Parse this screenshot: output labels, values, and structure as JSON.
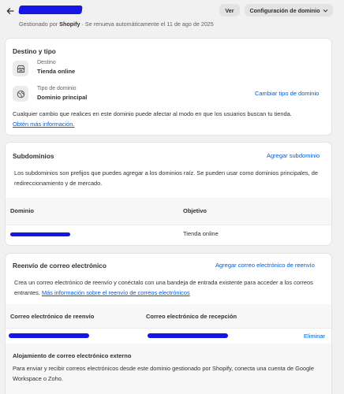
{
  "header": {
    "back_icon": "arrow-left-icon",
    "subtitle_prefix": "Gestionado por",
    "subtitle_brand": "Shopify",
    "subtitle_suffix": "· Se renueva automáticamente el 11 de ago de 2025",
    "view_button": "Ver",
    "config_button": "Configuración de dominio",
    "config_icon": "chevron-down-icon"
  },
  "destination": {
    "title": "Destino y tipo",
    "destino_label": "Destino",
    "destino_value": "Tienda online",
    "destino_icon": "store-icon",
    "type_label": "Tipo de dominio",
    "type_value": "Dominio principal",
    "type_icon": "globe-icon",
    "change_type_link": "Cambiar tipo de dominio",
    "notice": "Cualquier cambio que realices en este dominio puede afectar al modo en que los usuarios buscan tu tienda.",
    "learn_more": "Obtén más información."
  },
  "subdomains": {
    "title": "Subdominios",
    "add_link": "Agregar subdominio",
    "description": "Los subdominios son prefijos que puedes agregar a los dominios raíz. Se pueden usar como dominios principales, de redireccionamiento y de mercado.",
    "col_domain": "Dominio",
    "col_target": "Objetivo",
    "rows": [
      {
        "target": "Tienda online"
      }
    ]
  },
  "email": {
    "title": "Reenvío de correo electrónico",
    "add_link": "Agregar correo electrónico de reenvío",
    "description": "Crea un correo electrónico de reenvío y conéctalo con una bandeja de entrada existente para acceder a los correos entrantes.",
    "more_info": "Más información sobre el reenvío de correos electrónicos",
    "col_forward": "Correo electrónico de reenvío",
    "col_receive": "Correo electrónico de recepción",
    "delete_label": "Eliminar",
    "external_title": "Alojamiento de correo electrónico externo",
    "external_text": "Para enviar y recibir correos electrónicos desde este dominio gestionado por Shopify, conecta una cuenta de Google Workspace o Zoho."
  }
}
